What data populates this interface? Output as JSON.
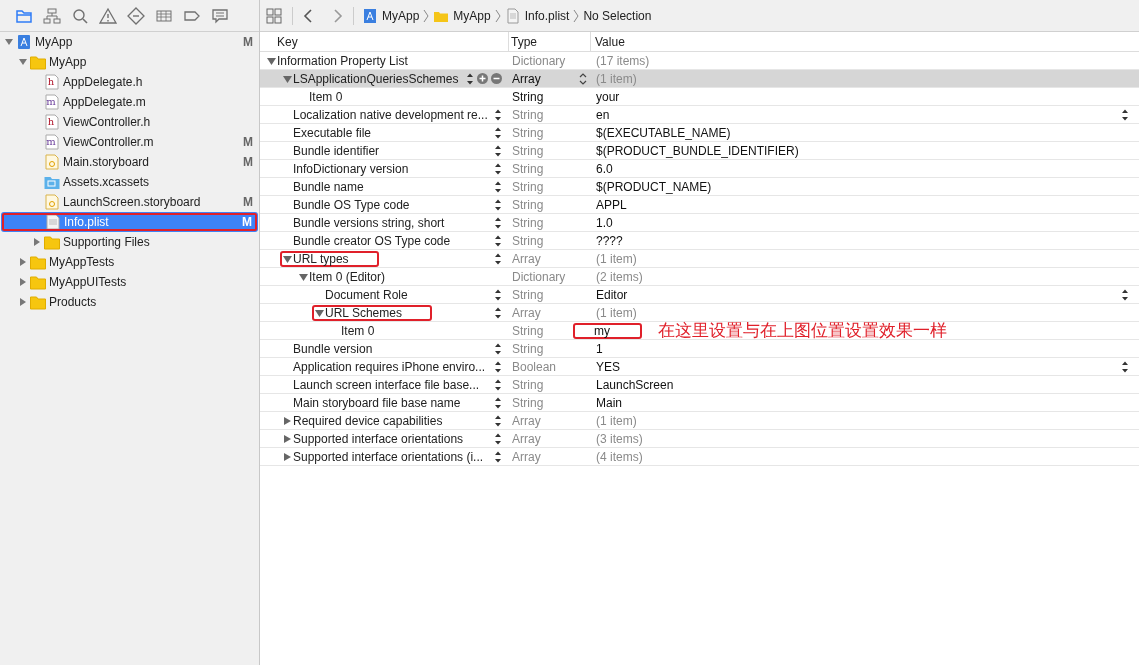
{
  "navigator_tabs": [
    {
      "selected": true
    },
    {
      "selected": false
    },
    {
      "selected": false
    },
    {
      "selected": false
    },
    {
      "selected": false
    },
    {
      "selected": false
    },
    {
      "selected": false
    },
    {
      "selected": false
    }
  ],
  "jump_bar": {
    "path": [
      "MyApp",
      "MyApp",
      "Info.plist",
      "No Selection"
    ]
  },
  "navigator": [
    {
      "name": "MyApp",
      "kind": "project",
      "badge": "M",
      "expanded": true,
      "selected": false,
      "highlighted": false,
      "children": [
        {
          "name": "MyApp",
          "kind": "folder",
          "expanded": true,
          "selected": false,
          "highlighted": false,
          "children": [
            {
              "name": "AppDelegate.h",
              "kind": "header",
              "icon_glyph": "h",
              "selected": false,
              "highlighted": false
            },
            {
              "name": "AppDelegate.m",
              "kind": "source",
              "icon_glyph": "m",
              "selected": false,
              "highlighted": false
            },
            {
              "name": "ViewController.h",
              "kind": "header",
              "icon_glyph": "h",
              "selected": false,
              "highlighted": false
            },
            {
              "name": "ViewController.m",
              "kind": "source",
              "icon_glyph": "m",
              "badge": "M",
              "selected": false,
              "highlighted": false
            },
            {
              "name": "Main.storyboard",
              "kind": "storyboard",
              "badge": "M",
              "selected": false,
              "highlighted": false
            },
            {
              "name": "Assets.xcassets",
              "kind": "assets",
              "selected": false,
              "highlighted": false
            },
            {
              "name": "LaunchScreen.storyboard",
              "kind": "storyboard",
              "badge": "M",
              "selected": false,
              "highlighted": false
            },
            {
              "name": "Info.plist",
              "kind": "plist",
              "badge": "M",
              "selected": true,
              "highlighted": true
            },
            {
              "name": "Supporting Files",
              "kind": "folder",
              "expanded": false,
              "selected": false,
              "highlighted": false
            }
          ]
        },
        {
          "name": "MyAppTests",
          "kind": "folder",
          "expanded": false,
          "selected": false,
          "highlighted": false
        },
        {
          "name": "MyAppUITests",
          "kind": "folder",
          "expanded": false,
          "selected": false,
          "highlighted": false
        },
        {
          "name": "Products",
          "kind": "folder",
          "expanded": false,
          "selected": false,
          "highlighted": false
        }
      ]
    }
  ],
  "plist": {
    "columns": [
      "Key",
      "Type",
      "Value"
    ],
    "rows": [
      {
        "key": "Information Property List",
        "type": "Dictionary",
        "value": "(17 items)",
        "kind": "collection",
        "expanded": true,
        "selected": false,
        "stepper": false,
        "children": [
          {
            "key": "LSApplicationQueriesSchemes",
            "type": "Array",
            "value": "(1 item)",
            "kind": "collection",
            "expanded": true,
            "selected": true,
            "stepper": true,
            "children": [
              {
                "key": "Item 0",
                "type": "String",
                "value": "your",
                "kind": "scalar",
                "selected": false,
                "stepper": false
              }
            ]
          },
          {
            "key": "Localization native development re...",
            "type": "String",
            "value": "en",
            "kind": "scalar",
            "selected": false,
            "stepper": true,
            "value_popup": true
          },
          {
            "key": "Executable file",
            "type": "String",
            "value": "$(EXECUTABLE_NAME)",
            "kind": "scalar",
            "selected": false,
            "stepper": true
          },
          {
            "key": "Bundle identifier",
            "type": "String",
            "value": "$(PRODUCT_BUNDLE_IDENTIFIER)",
            "kind": "scalar",
            "selected": false,
            "stepper": true
          },
          {
            "key": "InfoDictionary version",
            "type": "String",
            "value": "6.0",
            "kind": "scalar",
            "selected": false,
            "stepper": true
          },
          {
            "key": "Bundle name",
            "type": "String",
            "value": "$(PRODUCT_NAME)",
            "kind": "scalar",
            "selected": false,
            "stepper": true
          },
          {
            "key": "Bundle OS Type code",
            "type": "String",
            "value": "APPL",
            "kind": "scalar",
            "selected": false,
            "stepper": true
          },
          {
            "key": "Bundle versions string, short",
            "type": "String",
            "value": "1.0",
            "kind": "scalar",
            "selected": false,
            "stepper": true
          },
          {
            "key": "Bundle creator OS Type code",
            "type": "String",
            "value": "????",
            "kind": "scalar",
            "selected": false,
            "stepper": true
          },
          {
            "key": "URL types",
            "type": "Array",
            "value": "(1 item)",
            "kind": "collection",
            "expanded": true,
            "selected": false,
            "stepper": true,
            "highlighted": true,
            "children": [
              {
                "key": "Item 0 (Editor)",
                "type": "Dictionary",
                "value": "(2 items)",
                "kind": "collection",
                "expanded": true,
                "selected": false,
                "stepper": false,
                "children": [
                  {
                    "key": "Document Role",
                    "type": "String",
                    "value": "Editor",
                    "kind": "scalar",
                    "selected": false,
                    "stepper": true,
                    "value_popup": true
                  },
                  {
                    "key": "URL Schemes",
                    "type": "Array",
                    "value": "(1 item)",
                    "kind": "collection",
                    "expanded": true,
                    "selected": false,
                    "stepper": true,
                    "highlighted": true,
                    "children": [
                      {
                        "key": "Item 0",
                        "type": "String",
                        "value": "my",
                        "kind": "scalar",
                        "selected": false,
                        "stepper": false,
                        "value_highlighted": true,
                        "note": "在这里设置与在上图位置设置效果一样"
                      }
                    ]
                  }
                ]
              }
            ]
          },
          {
            "key": "Bundle version",
            "type": "String",
            "value": "1",
            "kind": "scalar",
            "selected": false,
            "stepper": true
          },
          {
            "key": "Application requires iPhone enviro...",
            "type": "Boolean",
            "value": "YES",
            "kind": "scalar",
            "selected": false,
            "stepper": true,
            "value_popup": true
          },
          {
            "key": "Launch screen interface file base...",
            "type": "String",
            "value": "LaunchScreen",
            "kind": "scalar",
            "selected": false,
            "stepper": true
          },
          {
            "key": "Main storyboard file base name",
            "type": "String",
            "value": "Main",
            "kind": "scalar",
            "selected": false,
            "stepper": true
          },
          {
            "key": "Required device capabilities",
            "type": "Array",
            "value": "(1 item)",
            "kind": "collection",
            "expanded": false,
            "selected": false,
            "stepper": true
          },
          {
            "key": "Supported interface orientations",
            "type": "Array",
            "value": "(3 items)",
            "kind": "collection",
            "expanded": false,
            "selected": false,
            "stepper": true
          },
          {
            "key": "Supported interface orientations (i...",
            "type": "Array",
            "value": "(4 items)",
            "kind": "collection",
            "expanded": false,
            "selected": false,
            "stepper": true
          }
        ]
      }
    ]
  }
}
